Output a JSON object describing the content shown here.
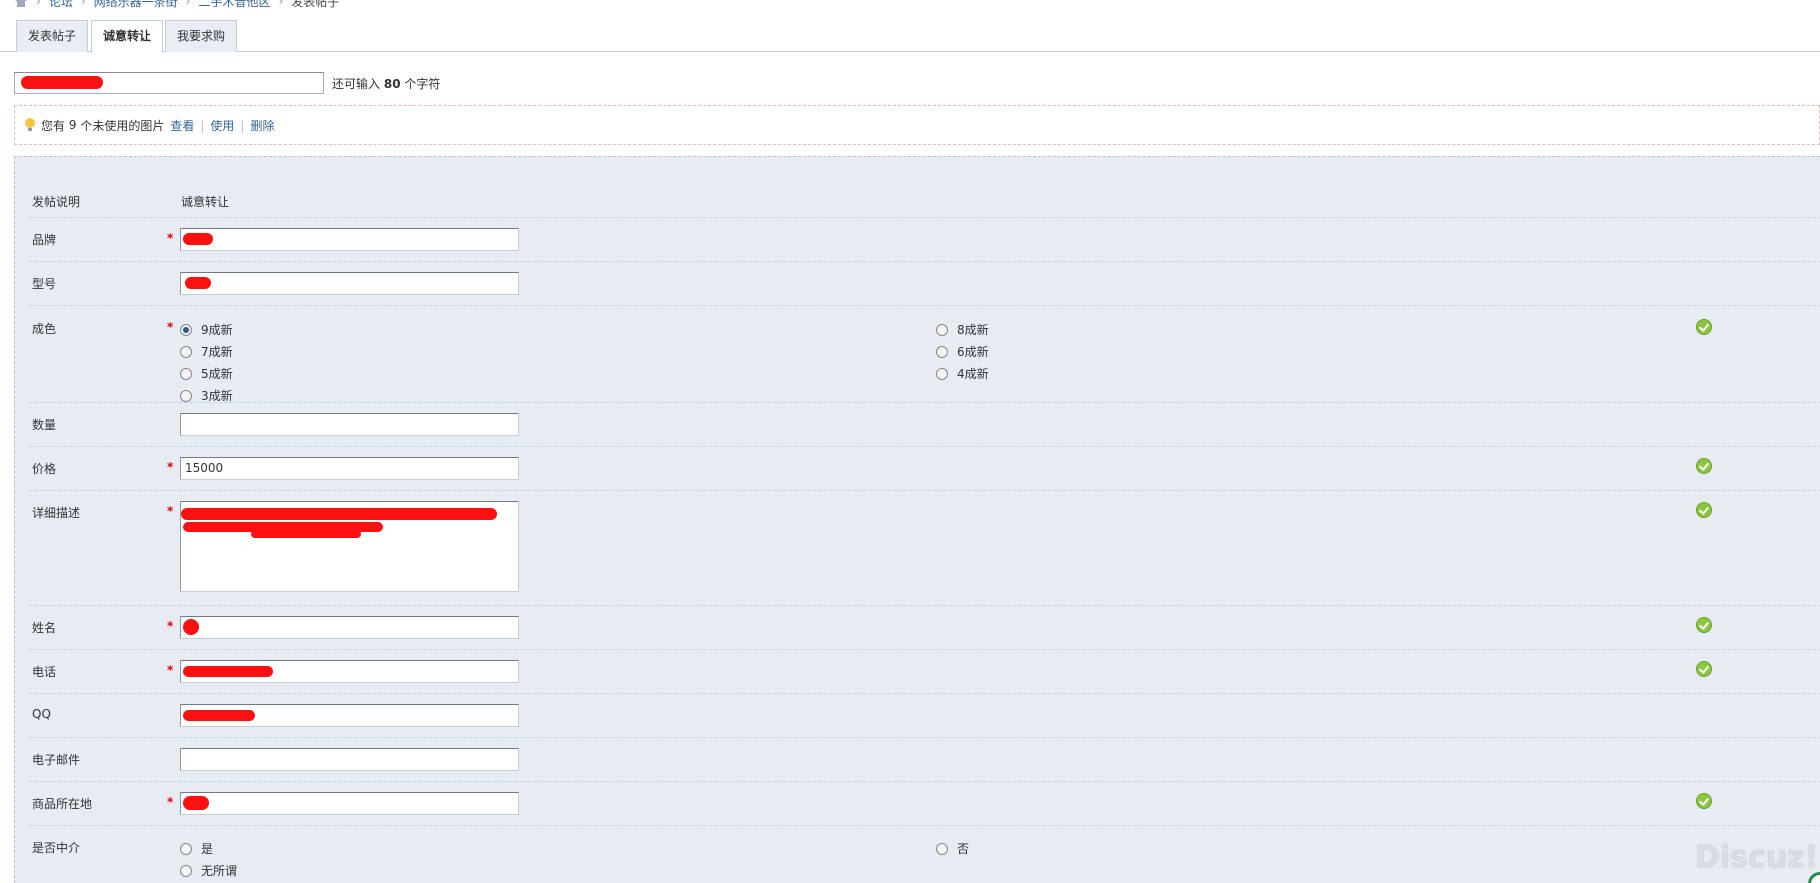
{
  "breadcrumb": {
    "items": [
      "论坛",
      "网络乐器一条街",
      "二手木音他区",
      "发表帖子"
    ]
  },
  "tabs": [
    {
      "label": "发表帖子",
      "active": false
    },
    {
      "label": "诚意转让",
      "active": true
    },
    {
      "label": "我要求购",
      "active": false
    }
  ],
  "subject": {
    "hint_prefix": "还可输入",
    "remaining": "80",
    "hint_suffix": "个字符"
  },
  "notice": {
    "text_prefix": "您有",
    "count": "9",
    "text_suffix": "个未使用的图片",
    "links": [
      "查看",
      "使用",
      "删除"
    ]
  },
  "form": {
    "post_desc": {
      "label": "发帖说明",
      "value": "诚意转让"
    },
    "brand": {
      "label": "品牌"
    },
    "model": {
      "label": "型号"
    },
    "condition": {
      "label": "成色",
      "options": [
        "9成新",
        "8成新",
        "7成新",
        "6成新",
        "5成新",
        "4成新",
        "3成新"
      ],
      "selected": "9成新"
    },
    "quantity": {
      "label": "数量"
    },
    "price": {
      "label": "价格",
      "value": "15000"
    },
    "description": {
      "label": "详细描述"
    },
    "name": {
      "label": "姓名"
    },
    "phone": {
      "label": "电话"
    },
    "qq": {
      "label": "QQ"
    },
    "email": {
      "label": "电子邮件"
    },
    "location": {
      "label": "商品所在地"
    },
    "agent": {
      "label": "是否中介",
      "options": [
        "是",
        "否",
        "无所谓"
      ]
    },
    "required_mark": "*"
  },
  "watermark": "Discuz!",
  "colors": {
    "panel_bg": "#e6ecf2",
    "link": "#336699",
    "required": "#dd0000",
    "valid_check": "#8cc63f",
    "redaction": "#ff1010"
  }
}
